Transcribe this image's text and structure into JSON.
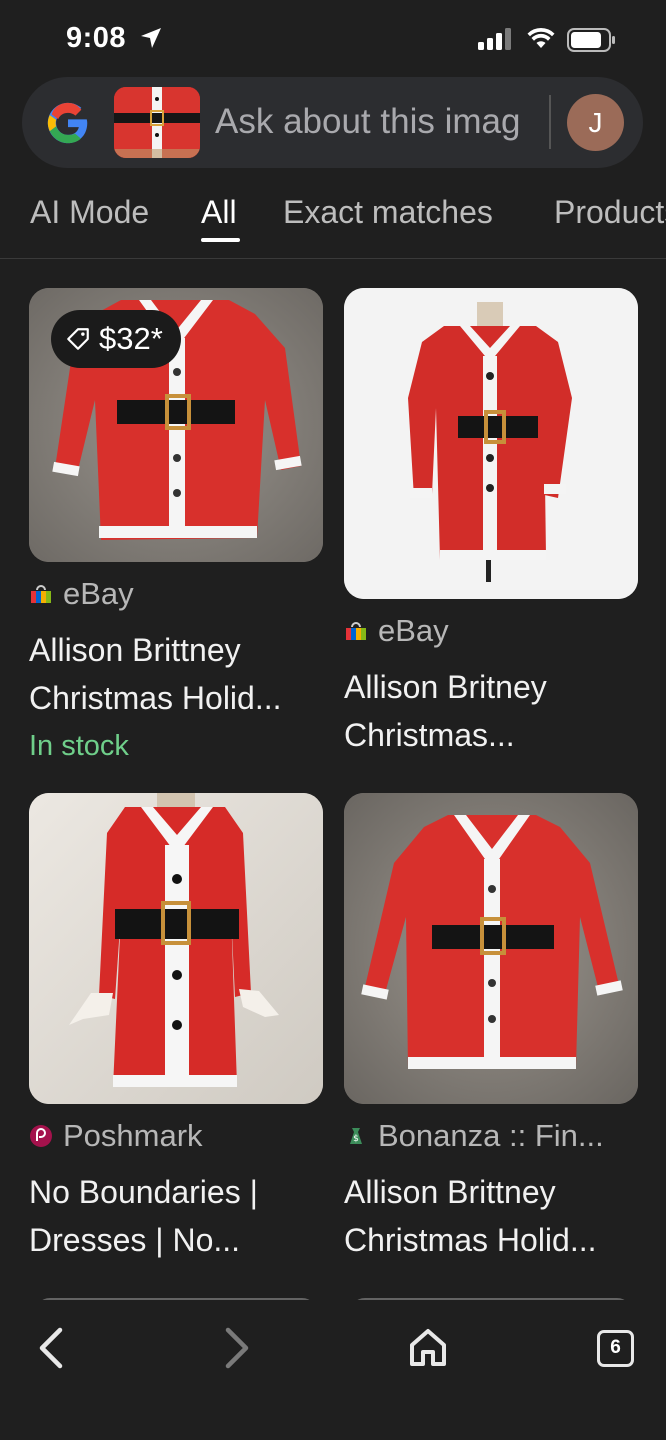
{
  "status_bar": {
    "time": "9:08",
    "icons": [
      "location-arrow-icon",
      "signal-icon",
      "wifi-icon",
      "battery-icon"
    ]
  },
  "search_bar": {
    "logo": "google-g-logo",
    "query_text": "Ask about this imag",
    "avatar_initial": "J"
  },
  "tabs": [
    {
      "label": "AI Mode",
      "active": false
    },
    {
      "label": "All",
      "active": true
    },
    {
      "label": "Exact matches",
      "active": false
    },
    {
      "label": "Products",
      "active": false
    }
  ],
  "results": [
    {
      "source": "eBay",
      "source_icon": "ebay-bag-icon",
      "title_line1": "Allison Brittney",
      "title_line2": "Christmas Holid...",
      "price": "$32*",
      "stock": "In stock"
    },
    {
      "source": "eBay",
      "source_icon": "ebay-bag-icon",
      "title_line1": "Allison Britney",
      "title_line2": "Christmas..."
    },
    {
      "source": "Poshmark",
      "source_icon": "poshmark-icon",
      "title_line1": "No Boundaries |",
      "title_line2": "Dresses | No..."
    },
    {
      "source": "Bonanza :: Fin...",
      "source_icon": "bonanza-icon",
      "title_line1": "Allison Brittney",
      "title_line2": "Christmas Holid..."
    }
  ],
  "bottom_nav": {
    "tab_count": "6",
    "icons": [
      "back-icon",
      "forward-icon",
      "home-icon",
      "tabs-icon"
    ]
  },
  "colors": {
    "background": "#1f1f1f",
    "search_bar": "#2c2d30",
    "in_stock_green": "#6fcf8a",
    "dress_red": "#d32a27"
  }
}
